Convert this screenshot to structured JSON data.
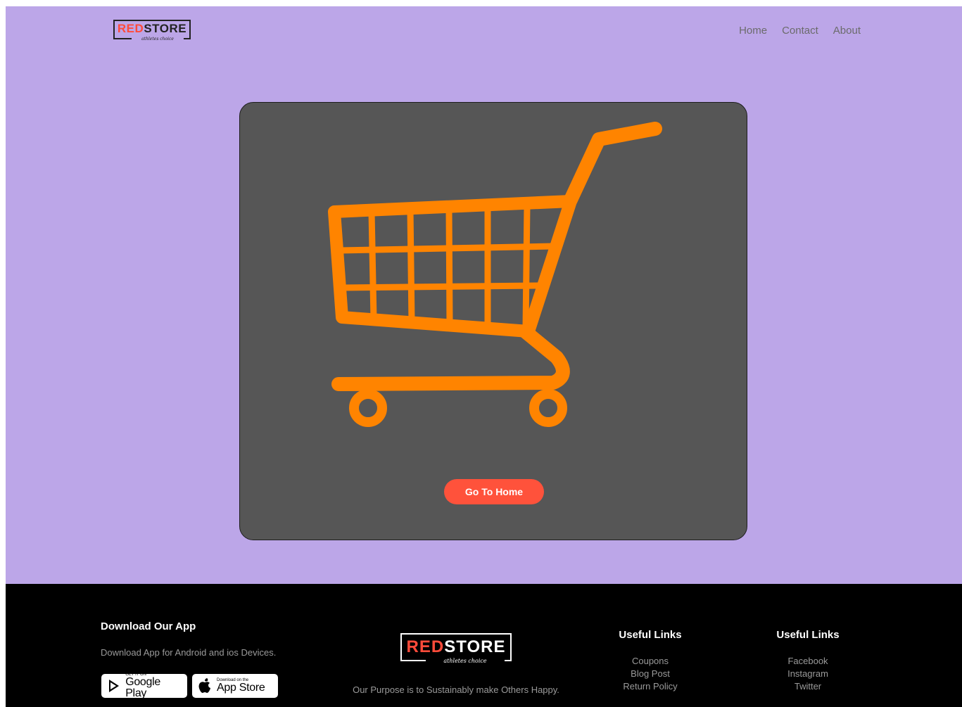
{
  "header": {
    "logo": {
      "red": "RED",
      "rest": "STORE",
      "tagline": "athletes choice"
    },
    "nav": [
      "Home",
      "Contact",
      "About"
    ]
  },
  "main": {
    "illustration": "shopping-cart-icon",
    "button_label": "Go To Home"
  },
  "footer": {
    "app": {
      "title": "Download Our App",
      "description": "Download App for Android and ios Devices.",
      "google_small": "GET IT ON",
      "google_big": "Google Play",
      "apple_small": "Download on the",
      "apple_big": "App Store"
    },
    "brand": {
      "logo": {
        "red": "RED",
        "rest": "STORE",
        "tagline": "athletes choice"
      },
      "purpose": "Our Purpose is to Sustainably make Others Happy."
    },
    "links1": {
      "title": "Useful Links",
      "items": [
        "Coupons",
        "Blog Post",
        "Return Policy"
      ]
    },
    "links2": {
      "title": "Useful Links",
      "items": [
        "Facebook",
        "Instagram",
        "Twitter"
      ]
    }
  },
  "colors": {
    "page_bg": "#bca6e8",
    "card_bg": "#565656",
    "cart_orange": "#ff8400",
    "button": "#ff523b",
    "footer_bg": "#000000"
  }
}
